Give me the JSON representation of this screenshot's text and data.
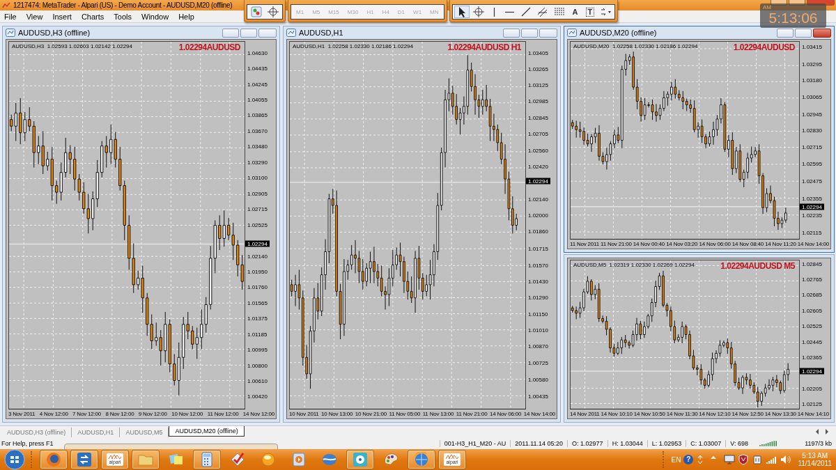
{
  "window": {
    "title": "1217474: MetaTrader - Alpari (US) - Demo Account - AUDUSD,M20 (offline)"
  },
  "menu": [
    "File",
    "View",
    "Insert",
    "Charts",
    "Tools",
    "Window",
    "Help"
  ],
  "charts_toolbar": [
    {
      "kind": "chart"
    },
    {
      "kind": "crosshair"
    }
  ],
  "periodicity_toolbar": [
    {
      "label": "M1",
      "disabled": true
    },
    {
      "label": "M5",
      "disabled": true
    },
    {
      "label": "M15",
      "disabled": true
    },
    {
      "label": "M30",
      "disabled": true
    },
    {
      "label": "H1",
      "disabled": true
    },
    {
      "label": "H4",
      "disabled": true
    },
    {
      "label": "D1",
      "disabled": true
    },
    {
      "label": "W1",
      "disabled": true
    },
    {
      "label": "MN",
      "disabled": true
    }
  ],
  "line_studies_toolbar": [
    {
      "kind": "cursor",
      "selected": true
    },
    {
      "kind": "crosshair",
      "selected": false
    },
    {
      "kind": "vline",
      "selected": false
    },
    {
      "kind": "hline",
      "selected": false
    },
    {
      "kind": "trend",
      "selected": false
    },
    {
      "kind": "channel",
      "selected": false
    },
    {
      "kind": "grid",
      "selected": false
    },
    {
      "kind": "text",
      "label": "A",
      "selected": false
    },
    {
      "kind": "label",
      "label": "T",
      "selected": false
    },
    {
      "kind": "arrows",
      "selected": false
    }
  ],
  "clock": {
    "meridiem": "AM",
    "time": "5:13:06"
  },
  "chart_windows": [
    {
      "title": "AUDUSD,H3 (offline)",
      "active": false,
      "info": "AUDUSD,H3  1.02593 1.02603 1.02142 1.02294",
      "overlay": "1.02294AUDUSD",
      "current_price": "1.02294",
      "price_ticks": [
        "1.04630",
        "1.04435",
        "1.04245",
        "1.04055",
        "1.03865",
        "1.03670",
        "1.03480",
        "1.03290",
        "1.03100",
        "1.02905",
        "1.02715",
        "1.02525",
        "1.02140",
        "1.01950",
        "1.01760",
        "1.01565",
        "1.01375",
        "1.01185",
        "1.00995",
        "1.00800",
        "1.00610",
        "1.00420"
      ],
      "time_labels": [
        "3 Nov 2011",
        "4 Nov 12:00",
        "7 Nov 12:00",
        "8 Nov 12:00",
        "9 Nov 12:00",
        "10 Nov 12:00",
        "11 Nov 12:00",
        "14 Nov 12:00"
      ]
    },
    {
      "title": "AUDUSD,H1",
      "active": false,
      "info": "AUDUSD,H1  1.02258 1.02330 1.02186 1.02294",
      "overlay": "1.02294AUDUSD H1",
      "current_price": "1.02294",
      "price_ticks": [
        "1.03405",
        "1.03265",
        "1.03125",
        "1.02985",
        "1.02845",
        "1.02705",
        "1.02560",
        "1.02420",
        "1.02140",
        "1.02000",
        "1.01860",
        "1.01715",
        "1.01570",
        "1.01430",
        "1.01290",
        "1.01150",
        "1.01010",
        "1.00870",
        "1.00725",
        "1.00580",
        "1.00435"
      ],
      "time_labels": [
        "10 Nov 2011",
        "10 Nov 13:00",
        "10 Nov 21:00",
        "11 Nov 05:00",
        "11 Nov 13:00",
        "11 Nov 21:00",
        "14 Nov 06:00",
        "14 Nov 14:00"
      ]
    },
    {
      "title": "AUDUSD,M20 (offline)",
      "active": true,
      "info": "AUDUSD,M20  1.02258 1.02330 1.02186 1.02294",
      "overlay": "1.02294AUDUSD",
      "current_price": "1.02294",
      "price_ticks": [
        "1.03415",
        "1.03295",
        "1.03180",
        "1.03065",
        "1.02945",
        "1.02830",
        "1.02715",
        "1.02595",
        "1.02475",
        "1.02355",
        "1.02235",
        "1.02115"
      ],
      "time_labels": [
        "11 Nov 2011",
        "11 Nov 21:00",
        "14 Nov 00:40",
        "14 Nov 03:20",
        "14 Nov 06:00",
        "14 Nov 08:40",
        "14 Nov 11:20",
        "14 Nov 14:00"
      ]
    },
    {
      "active": false,
      "info": "AUDUSD,M5  1.02319 1.02330 1.02269 1.02294",
      "overlay": "1.02294AUDUSD M5",
      "current_price": "1.02294",
      "price_ticks": [
        "1.02845",
        "1.02765",
        "1.02685",
        "1.02605",
        "1.02525",
        "1.02445",
        "1.02365",
        "1.02205",
        "1.02125"
      ],
      "time_labels": [
        "14 Nov 2011",
        "14 Nov 10:10",
        "14 Nov 10:50",
        "14 Nov 11:30",
        "14 Nov 12:10",
        "14 Nov 12:50",
        "14 Nov 13:30",
        "14 Nov 14:10"
      ]
    }
  ],
  "tabs": [
    {
      "label": "AUDUSD,H3 (offline)",
      "selected": false
    },
    {
      "label": "AUDUSD,H1",
      "selected": false
    },
    {
      "label": "AUDUSD,M5",
      "selected": false
    },
    {
      "label": "AUDUSD,M20 (offline)",
      "selected": true
    }
  ],
  "status_bar": {
    "help": "For Help, press F1",
    "fields": [
      "001-H3_H1_M20 - AU",
      "2011.11.14 05:20",
      "O: 1.02977",
      "H: 1.03044",
      "L: 1.02953",
      "C: 1.03007",
      "V: 698"
    ],
    "traffic": "1197/3 kb"
  },
  "taskbar": {
    "items": [
      {
        "kind": "browser",
        "open": true
      },
      {
        "kind": "sync",
        "open": true
      },
      {
        "kind": "alpari",
        "label": "alpari",
        "open": true
      },
      {
        "kind": "folder",
        "open": true
      },
      {
        "kind": "notes",
        "open": false
      },
      {
        "kind": "calculator",
        "open": true
      },
      {
        "kind": "check",
        "open": false
      },
      {
        "kind": "orb",
        "open": false
      },
      {
        "kind": "play",
        "open": false
      },
      {
        "kind": "wave",
        "open": false
      },
      {
        "kind": "disc",
        "open": true
      },
      {
        "kind": "palette",
        "open": false
      },
      {
        "kind": "globe",
        "open": true
      },
      {
        "kind": "alpari",
        "label": "alpari",
        "open": true
      }
    ],
    "tray": [
      {
        "kind": "lang",
        "label": "EN"
      },
      {
        "kind": "help",
        "label": "?"
      },
      {
        "kind": "arrows"
      },
      {
        "kind": "caret"
      },
      {
        "kind": "monitor"
      },
      {
        "kind": "shield"
      },
      {
        "kind": "device"
      },
      {
        "kind": "signal"
      },
      {
        "kind": "speaker"
      }
    ],
    "time": "5:13 AM",
    "date": "11/14/2011"
  }
}
